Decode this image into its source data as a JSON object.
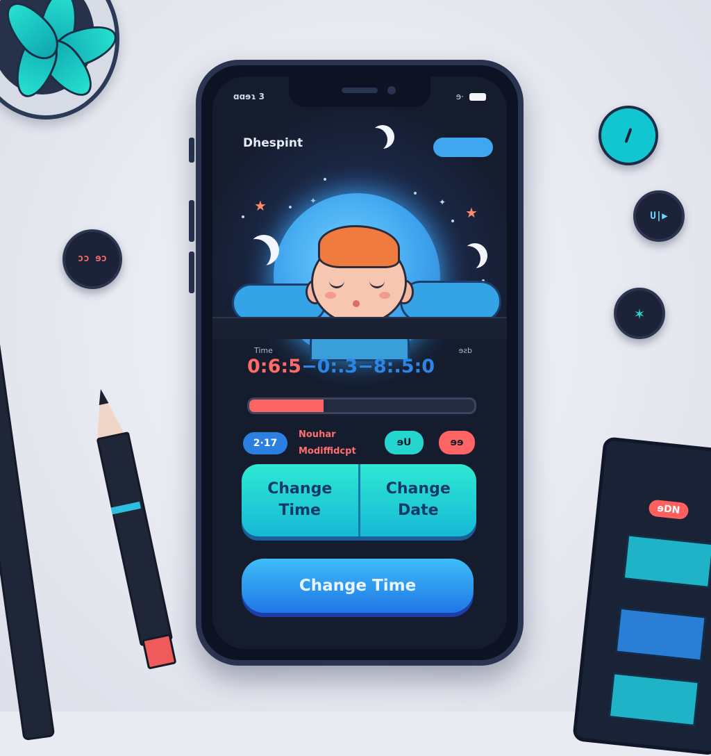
{
  "status": {
    "left": "ɑɑɘɿ 3",
    "right": "ɘ·"
  },
  "app": {
    "title": "Dhespint"
  },
  "scene": {
    "clock_icon": "gauge-icon"
  },
  "labels": {
    "time_label": "Time",
    "right_label": "ɘƨb"
  },
  "times": {
    "t1": "0:6:5",
    "sep1": "−0:.3",
    "sep2": "−8:.5:0"
  },
  "progress": {
    "value": 0.33
  },
  "chips": {
    "left": "2·17",
    "middle": "ɘU",
    "right": "ɘɘ"
  },
  "notes": {
    "line1": "Nouhar",
    "line2": "Modiffidcpt"
  },
  "buttons": {
    "change_time": "Change Time",
    "change_date": "Change Date",
    "main": "Change Time"
  },
  "desk": {
    "knob_left": "ɔɔ ɘɔ",
    "knob_right_mid": "U|▶",
    "tablet_badge": "ɘDN"
  },
  "colors": {
    "accent_teal": "#25d6cf",
    "accent_blue": "#2b7fe0",
    "accent_red": "#ff6464"
  }
}
